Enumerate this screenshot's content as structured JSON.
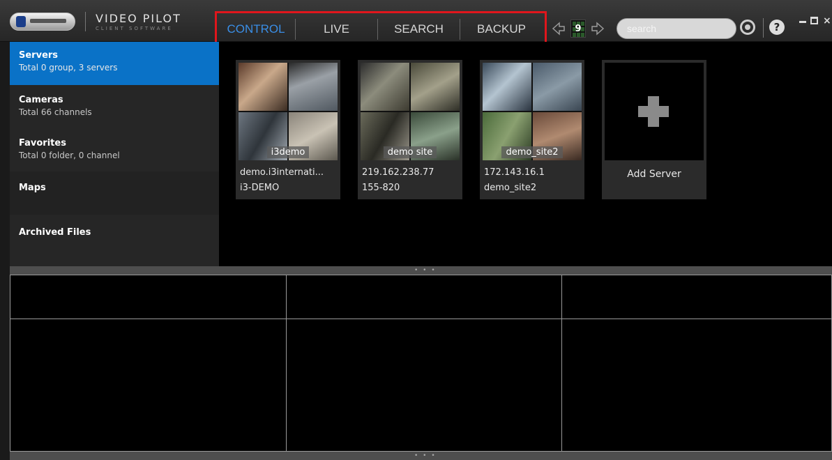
{
  "app": {
    "title": "VIDEO PILOT",
    "subtitle": "CLIENT SOFTWARE"
  },
  "modes": {
    "tabs": [
      {
        "label": "CONTROL",
        "active": true
      },
      {
        "label": "LIVE",
        "active": false
      },
      {
        "label": "SEARCH",
        "active": false
      },
      {
        "label": "BACKUP",
        "active": false
      }
    ],
    "highlight_color": "#e0161c",
    "active_color": "#3a8ee6"
  },
  "toolbar": {
    "grid_layout": "9",
    "search_placeholder": "search",
    "icons": [
      "arrow-left-icon",
      "grid-layout-icon",
      "arrow-right-icon",
      "record-icon",
      "help-icon",
      "minimize-icon",
      "maximize-icon",
      "close-icon"
    ]
  },
  "sidebar": {
    "accent": "#0a72c7",
    "items": [
      {
        "title": "Servers",
        "sub": "Total 0 group, 3 servers",
        "active": true
      },
      {
        "title": "Cameras",
        "sub": "Total 66 channels",
        "active": false
      },
      {
        "title": "Favorites",
        "sub": "Total 0 folder, 0 channel",
        "active": false
      },
      {
        "title": "Maps",
        "sub": "",
        "active": false
      },
      {
        "title": "Archived Files",
        "sub": "",
        "active": false
      }
    ]
  },
  "servers": [
    {
      "name": "i3demo",
      "line1": "demo.i3internati...",
      "line2": "i3-DEMO"
    },
    {
      "name": "demo site",
      "line1": "219.162.238.77",
      "line2": "155-820"
    },
    {
      "name": "demo_site2",
      "line1": "172.143.16.1",
      "line2": "demo_site2"
    }
  ],
  "add_server": {
    "label": "Add Server"
  },
  "video_grid": {
    "rows": 2,
    "cols": 3
  }
}
